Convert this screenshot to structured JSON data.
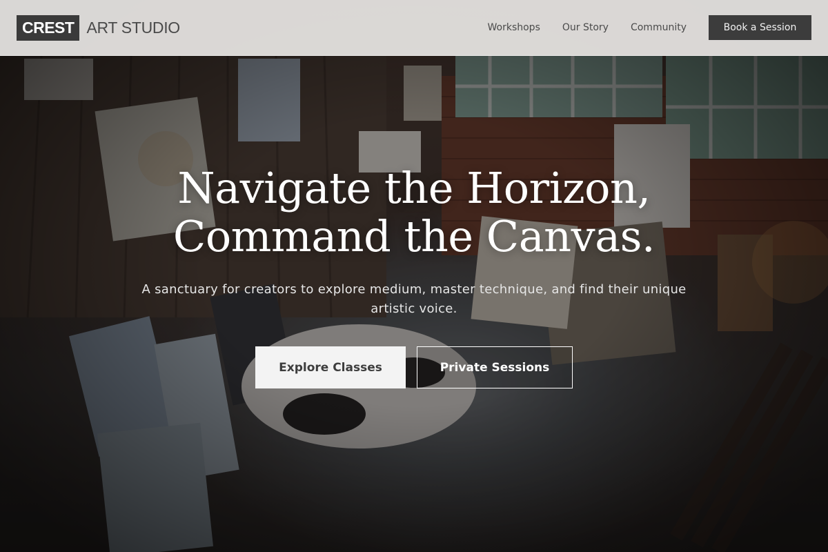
{
  "header": {
    "logo_box": "CREST",
    "logo_text": "ART STUDIO",
    "nav": [
      {
        "label": "Workshops"
      },
      {
        "label": "Our Story"
      },
      {
        "label": "Community"
      }
    ],
    "cta_label": "Book a Session"
  },
  "hero": {
    "title_line1": "Navigate the Horizon,",
    "title_line2": "Command the Canvas.",
    "subtitle": "A sanctuary for creators to explore medium, master technique, and find their unique artistic voice.",
    "primary_button": "Explore Classes",
    "secondary_button": "Private Sessions"
  },
  "colors": {
    "header_bg": "#e8e6e4",
    "logo_box_bg": "#3a3a3a",
    "cta_bg": "#3c3c3c",
    "primary_button_bg": "#f3f3f3",
    "text_light": "#ffffff"
  }
}
